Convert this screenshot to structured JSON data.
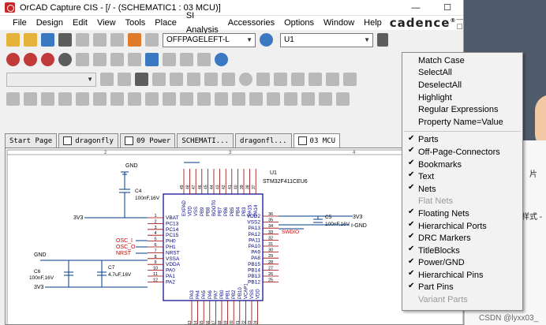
{
  "window": {
    "title": "OrCAD Capture CIS - [/ - (SCHEMATIC1 : 03 MCU)]",
    "controls": {
      "minimize": "—",
      "maximize": "☐",
      "close": "✕"
    }
  },
  "menubar": {
    "items": [
      "File",
      "Design",
      "Edit",
      "View",
      "Tools",
      "Place",
      "SI Analysis",
      "Accessories",
      "Options",
      "Window",
      "Help"
    ],
    "brand": "cadence"
  },
  "toolbar": {
    "offpage_combo": "OFFPAGELEFT-L",
    "search_combo": "U1"
  },
  "tabs": [
    {
      "label": "Start Page",
      "active": false
    },
    {
      "label": "dragonfly",
      "active": false
    },
    {
      "label": "09 Power",
      "active": false
    },
    {
      "label": "SCHEMATI...",
      "active": false
    },
    {
      "label": "dragonfl...",
      "active": false
    },
    {
      "label": "03 MCU",
      "active": true
    }
  ],
  "find_menu": {
    "options": [
      {
        "label": "Match Case",
        "checked": false,
        "enabled": true
      },
      {
        "label": "SelectAll",
        "checked": false,
        "enabled": true
      },
      {
        "label": "DeselectAll",
        "checked": false,
        "enabled": true
      },
      {
        "label": "Highlight",
        "checked": false,
        "enabled": true
      },
      {
        "label": "Regular Expressions",
        "checked": false,
        "enabled": true
      },
      {
        "label": "Property Name=Value",
        "checked": false,
        "enabled": true
      }
    ],
    "scope": [
      {
        "label": "Parts",
        "checked": true,
        "enabled": true
      },
      {
        "label": "Off-Page-Connectors",
        "checked": true,
        "enabled": true
      },
      {
        "label": "Bookmarks",
        "checked": true,
        "enabled": true
      },
      {
        "label": "Text",
        "checked": true,
        "enabled": true
      },
      {
        "label": "Nets",
        "checked": true,
        "enabled": true
      },
      {
        "label": "Flat Nets",
        "checked": false,
        "enabled": false
      },
      {
        "label": "Floating Nets",
        "checked": true,
        "enabled": true
      },
      {
        "label": "Hierarchical Ports",
        "checked": true,
        "enabled": true
      },
      {
        "label": "DRC Markers",
        "checked": true,
        "enabled": true
      },
      {
        "label": "TitleBlocks",
        "checked": true,
        "enabled": true
      },
      {
        "label": "Power/GND",
        "checked": true,
        "enabled": true
      },
      {
        "label": "Hierarchical Pins",
        "checked": true,
        "enabled": true
      },
      {
        "label": "Part Pins",
        "checked": true,
        "enabled": true
      },
      {
        "label": "Variant Parts",
        "checked": false,
        "enabled": false
      }
    ]
  },
  "schematic": {
    "ic_ref": "U1",
    "ic_part": "STM32F411CEU6",
    "left_pins": [
      {
        "num": "1",
        "name": "VBAT"
      },
      {
        "num": "2",
        "name": "PC13"
      },
      {
        "num": "3",
        "name": "PC14"
      },
      {
        "num": "4",
        "name": "PC15"
      },
      {
        "num": "5",
        "name": "PH0"
      },
      {
        "num": "6",
        "name": "PH1"
      },
      {
        "num": "7",
        "name": "NRST"
      },
      {
        "num": "8",
        "name": "VSSA"
      },
      {
        "num": "9",
        "name": "VDDA"
      },
      {
        "num": "10",
        "name": "PA0"
      },
      {
        "num": "11",
        "name": "PA1"
      },
      {
        "num": "12",
        "name": "PA2"
      }
    ],
    "right_pins": [
      {
        "num": "36",
        "name": "VDD2"
      },
      {
        "num": "35",
        "name": "VSS2"
      },
      {
        "num": "34",
        "name": "PA13"
      },
      {
        "num": "33",
        "name": "PA12"
      },
      {
        "num": "32",
        "name": "PA11"
      },
      {
        "num": "31",
        "name": "PA10"
      },
      {
        "num": "30",
        "name": "PA9"
      },
      {
        "num": "29",
        "name": "PA8"
      },
      {
        "num": "28",
        "name": "PB15"
      },
      {
        "num": "27",
        "name": "PB14"
      },
      {
        "num": "26",
        "name": "PB13"
      },
      {
        "num": "25",
        "name": "PB12"
      }
    ],
    "top_pins": [
      "EXPAD",
      "VDD",
      "VSS",
      "PB9",
      "PB8",
      "BOOT0",
      "PB7",
      "PB6",
      "PB5",
      "PB4",
      "PB3",
      "PA15",
      "PA14"
    ],
    "top_pin_nums": [
      "49",
      "48",
      "47",
      "46",
      "45",
      "44",
      "43",
      "42",
      "41",
      "40",
      "39",
      "38",
      "37"
    ],
    "bottom_pins": [
      "PA3",
      "PA4",
      "PA5",
      "PA6",
      "PA7",
      "PB0",
      "PB1",
      "PB2",
      "PB10",
      "VCAP1",
      "VSS",
      "VDD"
    ],
    "bottom_pin_nums": [
      "13",
      "14",
      "15",
      "16",
      "17",
      "18",
      "19",
      "20",
      "21",
      "22",
      "23",
      "24"
    ],
    "c4": {
      "ref": "C4",
      "value": "100nF,16V"
    },
    "c5": {
      "ref": "C5",
      "value": "100nF,16V"
    },
    "c6": {
      "ref": "C6",
      "value": "100nF,16V"
    },
    "c7": {
      "ref": "C7",
      "value": "4.7uF,16V"
    },
    "gnd_labels": [
      "GND",
      "GND",
      "I-GND"
    ],
    "net_3v3": "3V3",
    "osc_in": "OSC_I",
    "osc_out": "OSC_O",
    "nrst_net": "NRST",
    "swdio": "SWDIO",
    "col_markers": [
      "2",
      "3",
      "4",
      "5"
    ]
  },
  "desktop": {
    "partial_texts": [
      "片",
      "样式 -",
      "CSDN @lyxx03_"
    ]
  },
  "colors": {
    "wire": "#003b8a",
    "pin": "#9a0000",
    "part_body": "#00008b",
    "net_label": "#cc0000",
    "text": "#000080"
  }
}
